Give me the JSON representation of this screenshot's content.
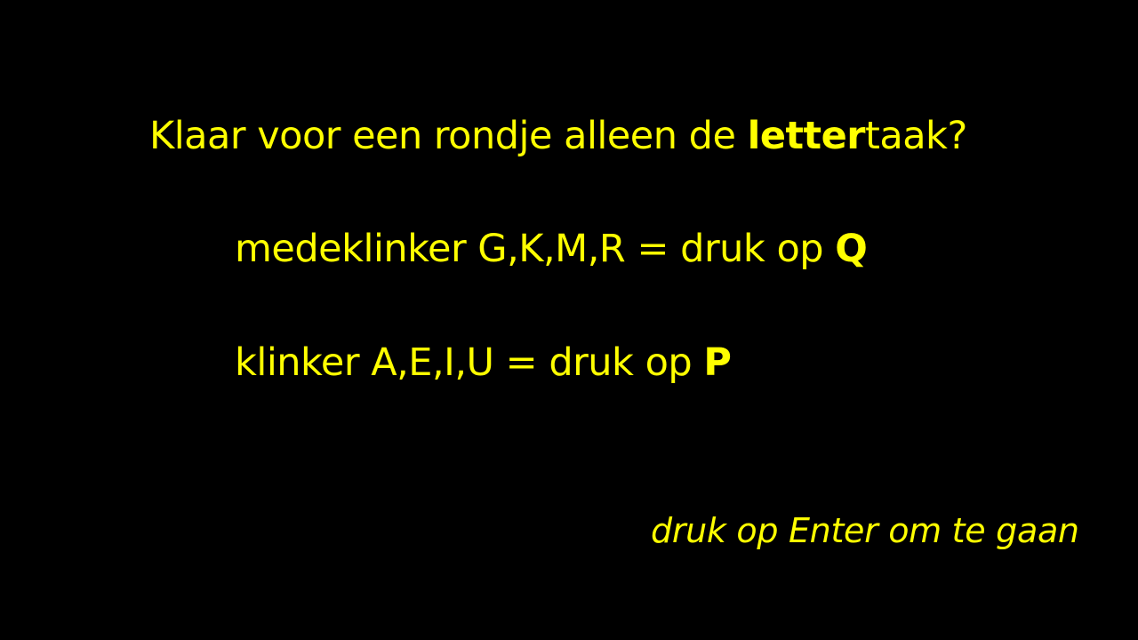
{
  "colors": {
    "background": "#000000",
    "text": "#ffff00"
  },
  "title": {
    "before": "Klaar voor een rondje alleen de ",
    "emphasis": "letter",
    "after": "taak?"
  },
  "rules": {
    "consonant": {
      "text": "medeklinker G,K,M,R = druk op ",
      "key": "Q"
    },
    "vowel": {
      "text": "klinker A,E,I,U = druk op ",
      "key": "P"
    }
  },
  "continue_prompt": "druk op Enter om te gaan"
}
